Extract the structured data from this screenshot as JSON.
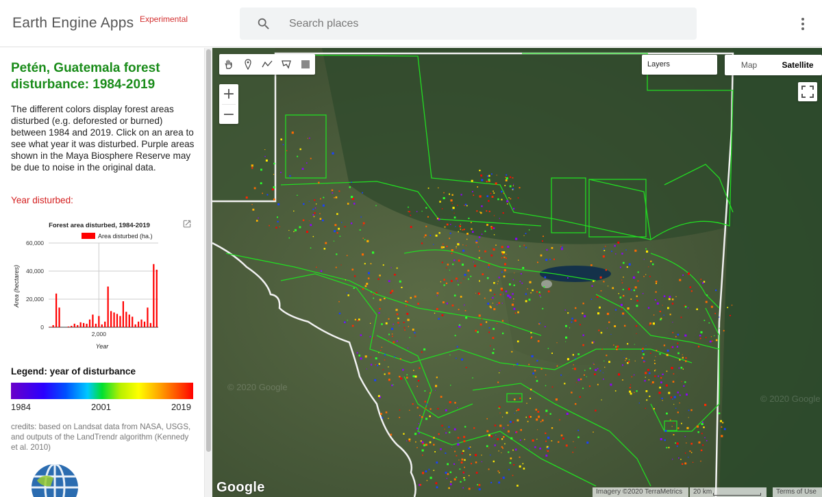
{
  "header": {
    "brand": "Earth Engine Apps",
    "brand_tag": "Experimental",
    "search_placeholder": "Search places"
  },
  "sidebar": {
    "title": "Petén, Guatemala forest disturbance: 1984-2019",
    "description": "The different colors display forest areas disturbed (e.g. deforested or burned) between 1984 and 2019. Click on an area to see what year it was disturbed. Purple areas shown in the Maya Biosphere Reserve may be due to noise in the original data.",
    "year_label": "Year disturbed:",
    "legend_title": "Legend: year of disturbance",
    "legend_ticks": [
      "1984",
      "2001",
      "2019"
    ],
    "credits": "credits: based on Landsat data from NASA, USGS, and outputs of the LandTrendr algorithm (Kennedy et al. 2010)"
  },
  "chart_data": {
    "type": "bar",
    "title": "Forest area disturbed, 1984-2019",
    "xlabel": "Year",
    "ylabel": "Area (hectares)",
    "legend": "Area disturbed (ha.)",
    "color": "#ff0000",
    "ylim": [
      0,
      60000
    ],
    "yticks": [
      "0",
      "20,000",
      "40,000",
      "60,000"
    ],
    "xtick_label": "2,000",
    "xtick_value": 2000,
    "x": [
      1984,
      1985,
      1986,
      1987,
      1988,
      1989,
      1990,
      1991,
      1992,
      1993,
      1994,
      1995,
      1996,
      1997,
      1998,
      1999,
      2000,
      2001,
      2002,
      2003,
      2004,
      2005,
      2006,
      2007,
      2008,
      2009,
      2010,
      2011,
      2012,
      2013,
      2014,
      2015,
      2016,
      2017,
      2018,
      2019
    ],
    "values": [
      300,
      1500,
      24000,
      14000,
      0,
      0,
      500,
      1000,
      2500,
      1500,
      3500,
      3000,
      2500,
      5500,
      9000,
      2500,
      8000,
      2000,
      4000,
      29000,
      11500,
      10500,
      9500,
      8000,
      18500,
      11000,
      9000,
      7500,
      2000,
      4000,
      5500,
      4000,
      14000,
      3000,
      45000,
      41000
    ]
  },
  "map": {
    "map_type_options": [
      "Map",
      "Satellite"
    ],
    "selected_map_type": "Satellite",
    "layers_label": "Layers",
    "google_logo": "Google",
    "watermark": "© 2020 Google",
    "imagery_credit": "Imagery ©2020 TerraMetrics",
    "scale_label": "20 km",
    "terms_label": "Terms of Use",
    "zoom_in": "+",
    "zoom_out": "−"
  }
}
